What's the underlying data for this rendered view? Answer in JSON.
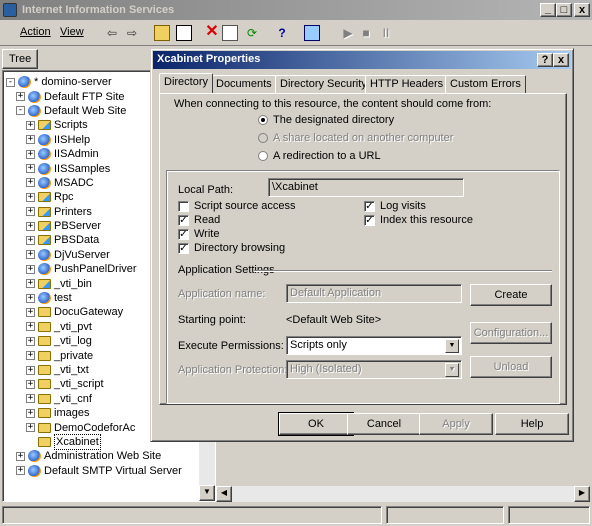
{
  "app": {
    "title": "Internet Information Services"
  },
  "menu": {
    "action": "Action",
    "view": "View"
  },
  "tree_tab": "Tree",
  "tree": [
    {
      "label": "* domino-server",
      "depth": 0,
      "icon": "server-icon",
      "pm": "-"
    },
    {
      "label": "Default FTP Site",
      "depth": 1,
      "icon": "ftp-site-icon",
      "pm": "+"
    },
    {
      "label": "Default Web Site",
      "depth": 1,
      "icon": "web-site-icon",
      "pm": "-"
    },
    {
      "label": "Scripts",
      "depth": 2,
      "icon": "vdir-folder-icon",
      "pm": "+"
    },
    {
      "label": "IISHelp",
      "depth": 2,
      "icon": "app-icon",
      "pm": "+"
    },
    {
      "label": "IISAdmin",
      "depth": 2,
      "icon": "app-icon",
      "pm": "+"
    },
    {
      "label": "IISSamples",
      "depth": 2,
      "icon": "app-icon",
      "pm": "+"
    },
    {
      "label": "MSADC",
      "depth": 2,
      "icon": "app-icon",
      "pm": "+"
    },
    {
      "label": "Rpc",
      "depth": 2,
      "icon": "vdir-folder-icon",
      "pm": "+"
    },
    {
      "label": "Printers",
      "depth": 2,
      "icon": "vdir-folder-icon",
      "pm": "+"
    },
    {
      "label": "PBServer",
      "depth": 2,
      "icon": "vdir-folder-icon",
      "pm": "+"
    },
    {
      "label": "PBSData",
      "depth": 2,
      "icon": "vdir-folder-icon",
      "pm": "+"
    },
    {
      "label": "DjVuServer",
      "depth": 2,
      "icon": "app-icon",
      "pm": "+"
    },
    {
      "label": "PushPanelDriver",
      "depth": 2,
      "icon": "app-icon",
      "pm": "+"
    },
    {
      "label": "_vti_bin",
      "depth": 2,
      "icon": "vdir-folder-icon",
      "pm": "+"
    },
    {
      "label": "test",
      "depth": 2,
      "icon": "app-icon",
      "pm": "+"
    },
    {
      "label": "DocuGateway",
      "depth": 2,
      "icon": "folder-icon",
      "pm": "+"
    },
    {
      "label": "_vti_pvt",
      "depth": 2,
      "icon": "folder-icon",
      "pm": "+"
    },
    {
      "label": "_vti_log",
      "depth": 2,
      "icon": "folder-icon",
      "pm": "+"
    },
    {
      "label": "_private",
      "depth": 2,
      "icon": "folder-icon",
      "pm": "+"
    },
    {
      "label": "_vti_txt",
      "depth": 2,
      "icon": "folder-icon",
      "pm": "+"
    },
    {
      "label": "_vti_script",
      "depth": 2,
      "icon": "folder-icon",
      "pm": "+"
    },
    {
      "label": "_vti_cnf",
      "depth": 2,
      "icon": "folder-icon",
      "pm": "+"
    },
    {
      "label": "images",
      "depth": 2,
      "icon": "folder-icon",
      "pm": "+"
    },
    {
      "label": "DemoCodeforAc",
      "depth": 2,
      "icon": "folder-icon",
      "pm": "+"
    },
    {
      "label": "Xcabinet",
      "depth": 2,
      "icon": "folder-icon",
      "pm": "",
      "selected": true
    },
    {
      "label": "Administration Web Site",
      "depth": 1,
      "icon": "web-site-icon",
      "pm": "+"
    },
    {
      "label": "Default SMTP Virtual Server",
      "depth": 1,
      "icon": "smtp-icon",
      "pm": "+"
    }
  ],
  "dialog": {
    "title": "Xcabinet Properties",
    "help_btn": "?",
    "close_btn": "x",
    "tabs": [
      "Directory",
      "Documents",
      "Directory Security",
      "HTTP Headers",
      "Custom Errors"
    ],
    "source_prompt": "When connecting to this resource, the content should come from:",
    "radio_1": "The designated directory",
    "radio_2": "A share located on another computer",
    "radio_3": "A redirection to a URL",
    "local_path_label": "Local Path:",
    "local_path_value": "\\Xcabinet",
    "cb_script": "Script source access",
    "cb_read": "Read",
    "cb_write": "Write",
    "cb_browse": "Directory browsing",
    "cb_log": "Log visits",
    "cb_index": "Index this resource",
    "check_mark": "✓",
    "app_settings": "Application Settings",
    "app_name_label": "Application name:",
    "app_name_value": "Default Application",
    "create_btn": "Create",
    "start_label": "Starting point:",
    "start_value": "<Default Web Site>",
    "config_btn": "Configuration...",
    "exec_label": "Execute Permissions:",
    "exec_value": "Scripts only",
    "protect_label": "Application Protection:",
    "protect_value": "High (Isolated)",
    "unload_btn": "Unload",
    "ok_btn": "OK",
    "cancel_btn": "Cancel",
    "apply_btn": "Apply",
    "help_button": "Help"
  },
  "window_controls": {
    "min": "_",
    "max": "□",
    "close": "x"
  }
}
